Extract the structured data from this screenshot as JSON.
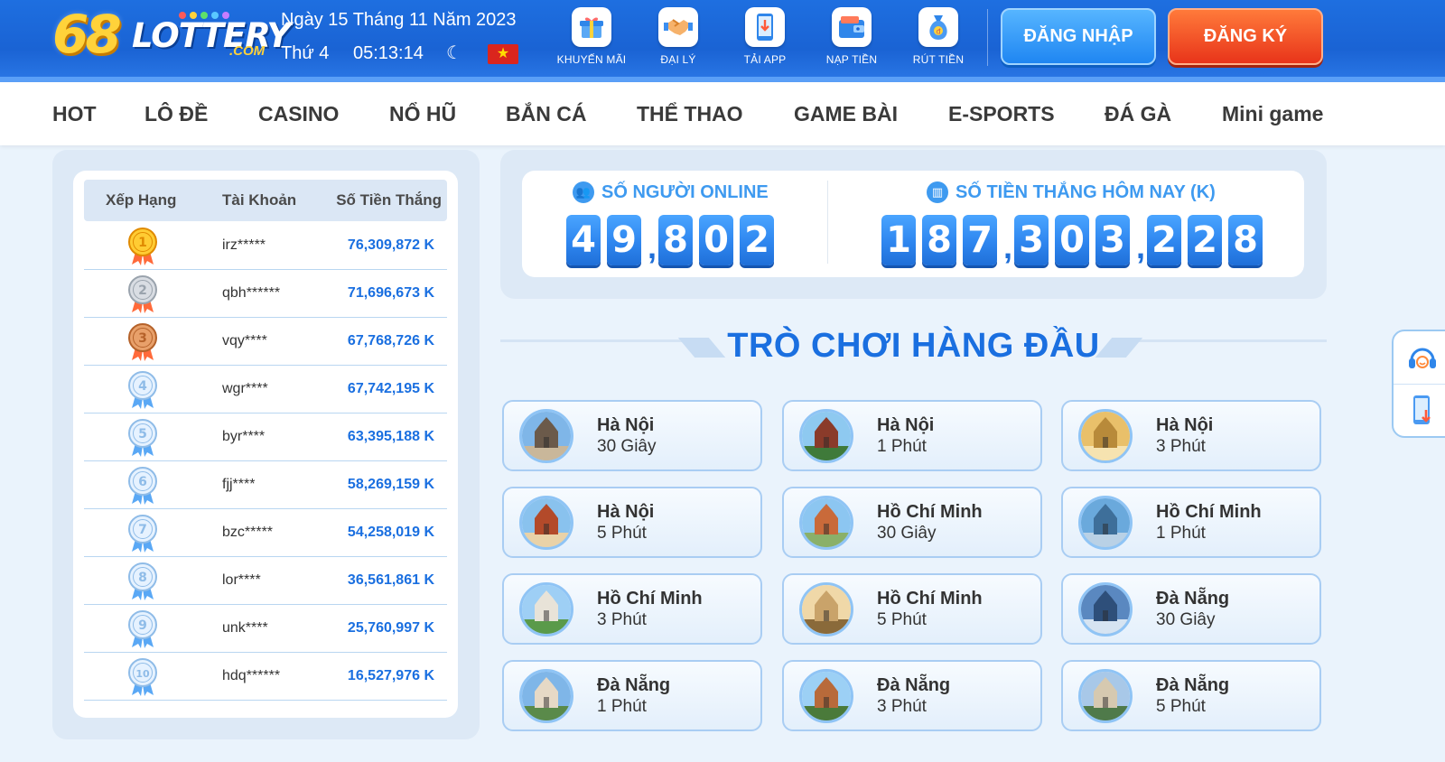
{
  "header": {
    "logo_text": "68LOTTERY",
    "logo_number": "68",
    "logo_word": "LOTTERY",
    "logo_domain": ".COM",
    "date_line": "Ngày 15 Tháng 11 Năm 2023",
    "weekday": "Thứ 4",
    "clock": "05:13:14",
    "actions": [
      {
        "label": "KHUYẾN MÃI",
        "icon": "gift-icon"
      },
      {
        "label": "ĐẠI LÝ",
        "icon": "handshake-icon"
      },
      {
        "label": "TẢI APP",
        "icon": "download-app-icon"
      },
      {
        "label": "NẠP TIỀN",
        "icon": "wallet-icon"
      },
      {
        "label": "RÚT TIỀN",
        "icon": "money-bag-icon"
      }
    ],
    "login_label": "ĐĂNG NHẬP",
    "register_label": "ĐĂNG KÝ"
  },
  "nav": {
    "items": [
      "HOT",
      "LÔ ĐỀ",
      "CASINO",
      "NỔ HŨ",
      "BẮN CÁ",
      "THỂ THAO",
      "GAME BÀI",
      "E-SPORTS",
      "ĐÁ GÀ",
      "Mini game"
    ]
  },
  "leaderboard": {
    "headers": {
      "rank": "Xếp Hạng",
      "account": "Tài Khoản",
      "amount": "Số Tiền Thắng"
    },
    "rows": [
      {
        "rank": "1",
        "account": "irz*****",
        "amount": "76,309,872 K"
      },
      {
        "rank": "2",
        "account": "qbh******",
        "amount": "71,696,673 K"
      },
      {
        "rank": "3",
        "account": "vqy****",
        "amount": "67,768,726 K"
      },
      {
        "rank": "4",
        "account": "wgr****",
        "amount": "67,742,195 K"
      },
      {
        "rank": "5",
        "account": "byr****",
        "amount": "63,395,188 K"
      },
      {
        "rank": "6",
        "account": "fjj****",
        "amount": "58,269,159 K"
      },
      {
        "rank": "7",
        "account": "bzc*****",
        "amount": "54,258,019 K"
      },
      {
        "rank": "8",
        "account": "lor****",
        "amount": "36,561,861 K"
      },
      {
        "rank": "9",
        "account": "unk****",
        "amount": "25,760,997 K"
      },
      {
        "rank": "10",
        "account": "hdq******",
        "amount": "16,527,976 K"
      }
    ]
  },
  "stats": {
    "online_label": "SỐ NGƯỜI ONLINE",
    "online_value": "49,802",
    "winnings_label": "SỐ TIỀN THẮNG HÔM NAY (K)",
    "winnings_value": "187,303,228"
  },
  "top_games": {
    "title": "TRÒ CHƠI HÀNG ĐẦU",
    "games": [
      {
        "name": "Hà Nội",
        "time": "30 Giây"
      },
      {
        "name": "Hà Nội",
        "time": "1 Phút"
      },
      {
        "name": "Hà Nội",
        "time": "3 Phút"
      },
      {
        "name": "Hà Nội",
        "time": "5 Phút"
      },
      {
        "name": "Hồ Chí Minh",
        "time": "30 Giây"
      },
      {
        "name": "Hồ Chí Minh",
        "time": "1 Phút"
      },
      {
        "name": "Hồ Chí Minh",
        "time": "3 Phút"
      },
      {
        "name": "Hồ Chí Minh",
        "time": "5 Phút"
      },
      {
        "name": "Đà Nẵng",
        "time": "30 Giây"
      },
      {
        "name": "Đà Nẵng",
        "time": "1 Phút"
      },
      {
        "name": "Đà Nẵng",
        "time": "3 Phút"
      },
      {
        "name": "Đà Nẵng",
        "time": "5 Phút"
      }
    ]
  },
  "colors": {
    "header_blue": "#1a63d4",
    "accent_blue": "#1a6fe0",
    "register_orange": "#e8341a",
    "gold": "#ffd23a"
  }
}
